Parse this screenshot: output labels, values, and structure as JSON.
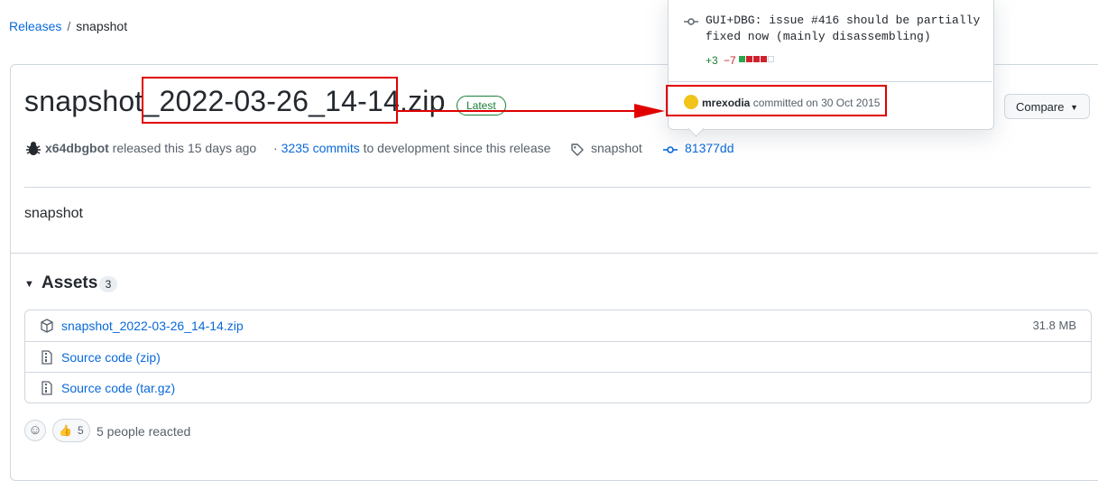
{
  "breadcrumb": {
    "releases": "Releases",
    "separator": "/",
    "current": "snapshot"
  },
  "release": {
    "title": "snapshot_2022-03-26_14-14.zip",
    "latest_badge": "Latest",
    "author": "x64dbgbot",
    "released_text": "released this 15 days ago",
    "commits_link": "3235 commits",
    "commits_suffix": "to development since this release",
    "tag": "snapshot",
    "commit_sha": "81377dd",
    "compare_label": "Compare",
    "body": "snapshot"
  },
  "assets": {
    "heading": "Assets",
    "count": "3",
    "items": [
      {
        "name": "snapshot_2022-03-26_14-14.zip",
        "sub": "",
        "size": "31.8 MB",
        "icon": "package-icon"
      },
      {
        "name": "Source code",
        "sub": "(zip)",
        "size": "",
        "icon": "file-zip-icon"
      },
      {
        "name": "Source code",
        "sub": "(tar.gz)",
        "size": "",
        "icon": "file-zip-icon"
      }
    ]
  },
  "reactions": {
    "emoji": "👍",
    "count": "5",
    "summary": "5 people reacted"
  },
  "popover": {
    "message": "GUI+DBG: issue #416 should be partially fixed now (mainly disassembling)",
    "additions": "+3",
    "deletions": "−7",
    "author": "mrexodia",
    "committed_text": "committed on 30 Oct 2015"
  },
  "colors": {
    "link": "#0969da",
    "latest": "#1a7f37",
    "annotation": "#e00000"
  }
}
